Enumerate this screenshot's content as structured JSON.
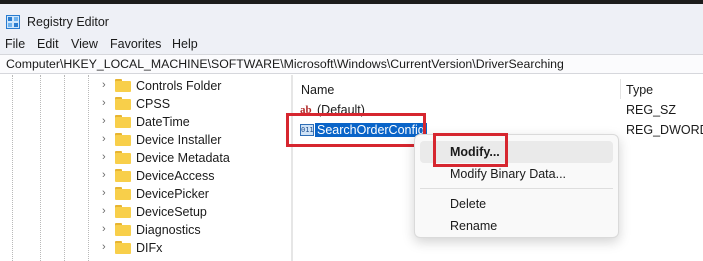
{
  "window": {
    "title": "Registry Editor"
  },
  "menu": [
    "File",
    "Edit",
    "View",
    "Favorites",
    "Help"
  ],
  "address": {
    "value": "Computer\\HKEY_LOCAL_MACHINE\\SOFTWARE\\Microsoft\\Windows\\CurrentVersion\\DriverSearching"
  },
  "tree": {
    "items": [
      "Controls Folder",
      "CPSS",
      "DateTime",
      "Device Installer",
      "Device Metadata",
      "DeviceAccess",
      "DevicePicker",
      "DeviceSetup",
      "Diagnostics",
      "DIFx"
    ]
  },
  "values": {
    "columns": {
      "name": "Name",
      "type": "Type"
    },
    "rows": [
      {
        "icon": "string-value-icon",
        "icon_glyph": "ab",
        "name": "(Default)",
        "type": "REG_SZ"
      },
      {
        "icon": "binary-value-icon",
        "icon_glyph": "011",
        "name": "SearchOrderConfig",
        "type": "REG_DWORD",
        "selected": true
      }
    ]
  },
  "context_menu": {
    "items": [
      "Modify...",
      "Modify Binary Data...",
      "Delete",
      "Rename"
    ]
  },
  "colors": {
    "selection": "#0a64c8",
    "highlight_box": "#d6262f",
    "folder": "#f8cf4a"
  }
}
